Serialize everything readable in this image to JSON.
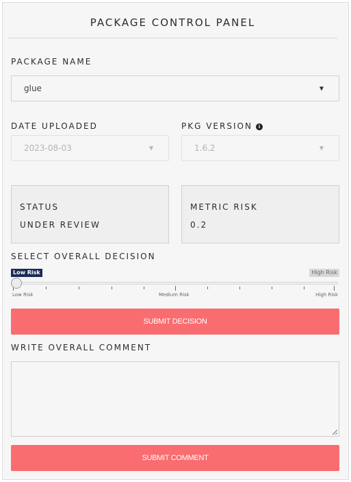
{
  "panel": {
    "title": "PACKAGE CONTROL PANEL"
  },
  "package_name": {
    "label": "PACKAGE NAME",
    "value": "glue",
    "icon": "caret-down-icon"
  },
  "date_uploaded": {
    "label": "DATE UPLOADED",
    "value": "2023-08-03",
    "icon": "caret-down-icon"
  },
  "pkg_version": {
    "label": "PKG VERSION",
    "value": "1.6.2",
    "info_icon": "info-icon",
    "info_glyph": "i",
    "icon": "caret-down-icon"
  },
  "status": {
    "label": "STATUS",
    "value": "UNDER REVIEW"
  },
  "metric_risk": {
    "label": "METRIC RISK",
    "value": "0.2"
  },
  "decision": {
    "label": "SELECT OVERALL DECISION",
    "selected_badge": "Low Risk",
    "max_badge": "High Risk",
    "ticks": [
      "Low Risk",
      "Medium Risk",
      "High Risk"
    ],
    "position": 0
  },
  "submit_decision": {
    "label": "SUBMIT DECISION"
  },
  "comment": {
    "label": "WRITE OVERALL COMMENT",
    "value": ""
  },
  "submit_comment": {
    "label": "SUBMIT COMMENT"
  },
  "colors": {
    "accent": "#f96c6f",
    "badge_low": "#1d2b55",
    "panel_bg": "#f6f6f7"
  }
}
